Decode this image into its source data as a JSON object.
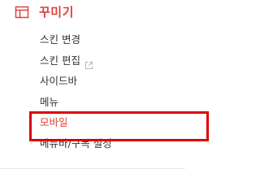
{
  "menu": {
    "title": "꾸미기",
    "icon": "layout-icon",
    "accent_color": "#e0403a",
    "items": [
      {
        "label": "스킨 변경",
        "external": false,
        "active": false
      },
      {
        "label": "스킨 편집",
        "external": true,
        "active": false
      },
      {
        "label": "사이드바",
        "external": false,
        "active": false
      },
      {
        "label": "메뉴",
        "external": false,
        "active": false
      },
      {
        "label": "모바일",
        "external": false,
        "active": true
      },
      {
        "label": "메뉴바/구독 설정",
        "external": false,
        "active": false
      }
    ]
  },
  "annotation": {
    "highlight_color": "#e00000"
  }
}
